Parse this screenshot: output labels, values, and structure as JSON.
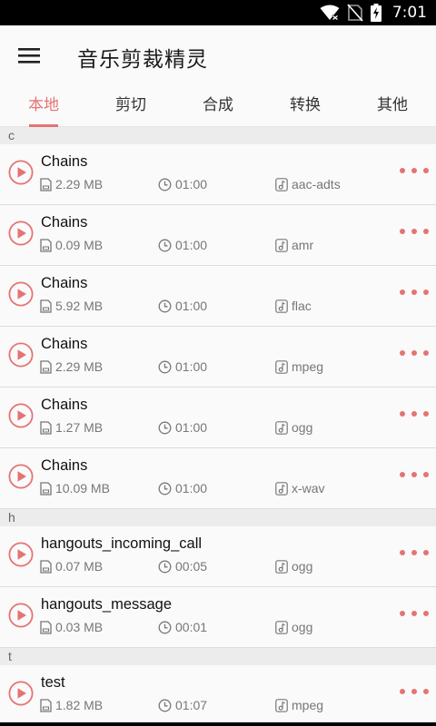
{
  "status_bar": {
    "time": "7:01"
  },
  "app_bar": {
    "title": "音乐剪裁精灵"
  },
  "tabs": [
    {
      "label": "本地",
      "active": true
    },
    {
      "label": "剪切",
      "active": false
    },
    {
      "label": "合成",
      "active": false
    },
    {
      "label": "转换",
      "active": false
    },
    {
      "label": "其他",
      "active": false
    }
  ],
  "sections": [
    {
      "header": "c",
      "items": [
        {
          "title": "Chains",
          "size": "2.29 MB",
          "duration": "01:00",
          "format": "aac-adts"
        },
        {
          "title": "Chains",
          "size": "0.09 MB",
          "duration": "01:00",
          "format": "amr"
        },
        {
          "title": "Chains",
          "size": "5.92 MB",
          "duration": "01:00",
          "format": "flac"
        },
        {
          "title": "Chains",
          "size": "2.29 MB",
          "duration": "01:00",
          "format": "mpeg"
        },
        {
          "title": "Chains",
          "size": "1.27 MB",
          "duration": "01:00",
          "format": "ogg"
        },
        {
          "title": "Chains",
          "size": "10.09 MB",
          "duration": "01:00",
          "format": "x-wav"
        }
      ]
    },
    {
      "header": "h",
      "items": [
        {
          "title": "hangouts_incoming_call",
          "size": "0.07 MB",
          "duration": "00:05",
          "format": "ogg"
        },
        {
          "title": "hangouts_message",
          "size": "0.03 MB",
          "duration": "00:01",
          "format": "ogg"
        }
      ]
    },
    {
      "header": "t",
      "items": [
        {
          "title": "test",
          "size": "1.82 MB",
          "duration": "01:07",
          "format": "mpeg"
        }
      ]
    }
  ],
  "icons": {
    "play": "play-circle-icon",
    "size": "sd-card-icon",
    "duration": "clock-icon",
    "format": "music-note-icon",
    "more": "more-horiz-icon"
  },
  "colors": {
    "accent": "#e57373",
    "status_bar": "#000000",
    "app_bar": "#fafafa"
  }
}
